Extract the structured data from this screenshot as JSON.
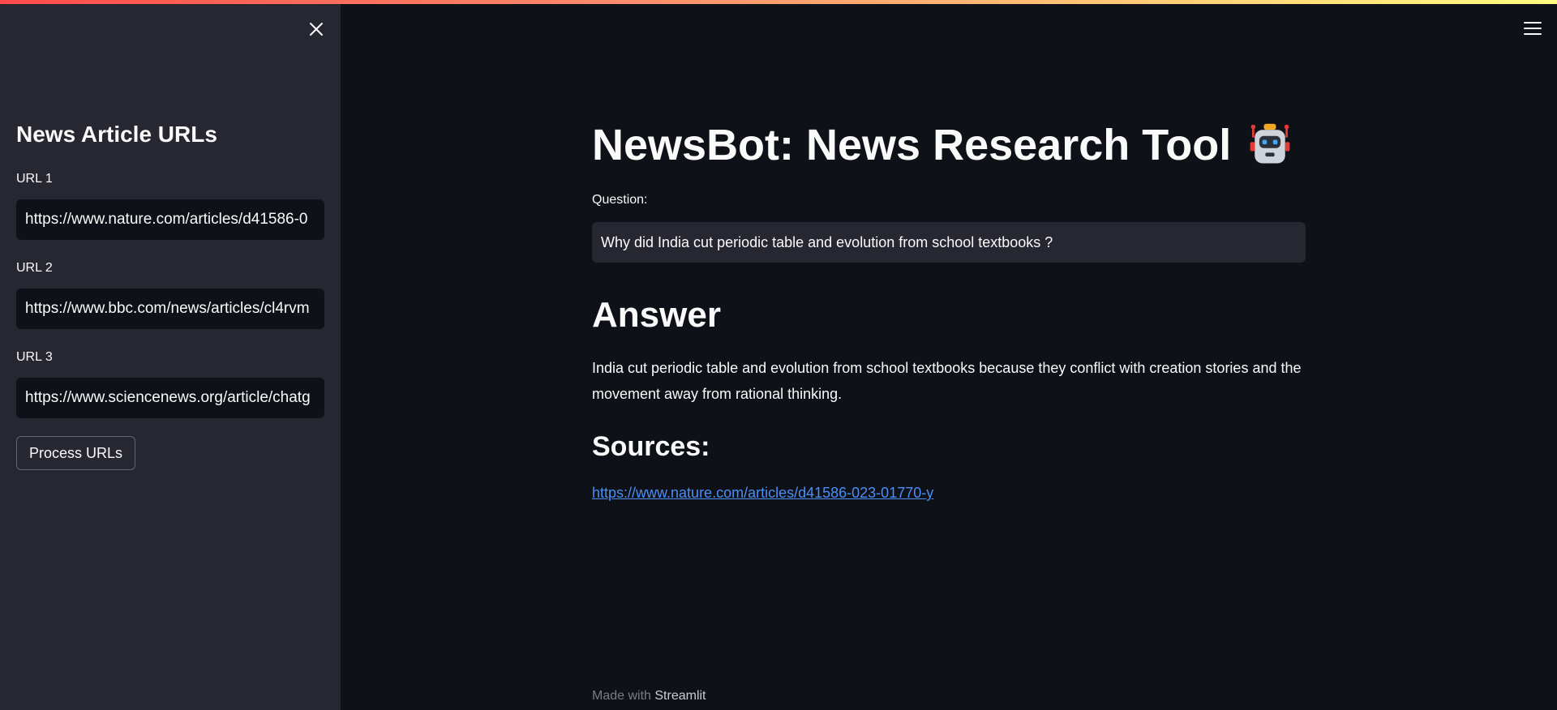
{
  "sidebar": {
    "title": "News Article URLs",
    "urls": [
      {
        "label": "URL 1",
        "value": "https://www.nature.com/articles/d41586-0"
      },
      {
        "label": "URL 2",
        "value": "https://www.bbc.com/news/articles/cl4rvm"
      },
      {
        "label": "URL 3",
        "value": "https://www.sciencenews.org/article/chatg"
      }
    ],
    "process_button": "Process URLs"
  },
  "main": {
    "title": "NewsBot: News Research Tool",
    "question_label": "Question:",
    "question_value": "Why did India cut periodic table and evolution from school textbooks ?",
    "answer_heading": "Answer",
    "answer_text": "India cut periodic table and evolution from school textbooks because they conflict with creation stories and the movement away from rational thinking.",
    "sources_heading": "Sources:",
    "source_link": "https://www.nature.com/articles/d41586-023-01770-y"
  },
  "footer": {
    "prefix": "Made with",
    "brand": "Streamlit"
  },
  "colors": {
    "background": "#0e1117",
    "sidebar": "#262730",
    "link": "#4b8ff5"
  }
}
